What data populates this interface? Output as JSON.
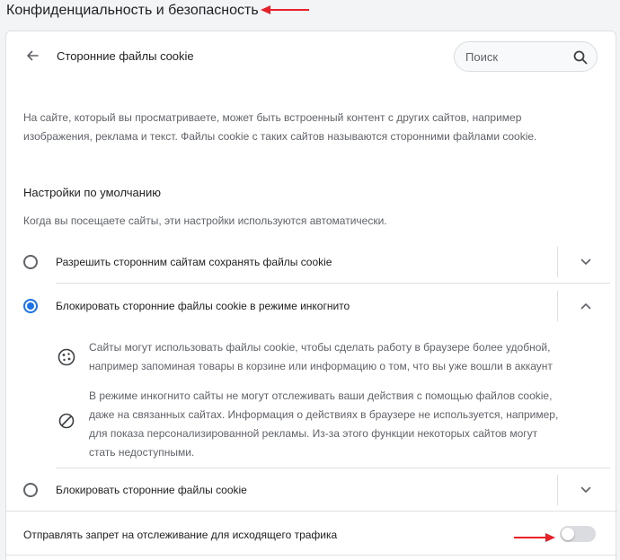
{
  "page": {
    "title": "Конфиденциальность и безопасность"
  },
  "header": {
    "title": "Сторонние файлы cookie",
    "search_placeholder": "Поиск"
  },
  "description": {
    "line1": "На сайте, который вы просматриваете, может быть встроенный контент с других сайтов, например",
    "line2": "изображения, реклама и текст. Файлы cookie с таких сайтов называются сторонними файлами cookie."
  },
  "defaults": {
    "title": "Настройки по умолчанию",
    "subtitle": "Когда вы посещаете сайты, эти настройки используются автоматически."
  },
  "options": [
    {
      "label": "Разрешить сторонним сайтам сохранять файлы cookie",
      "checked": false,
      "expanded": false
    },
    {
      "label": "Блокировать сторонние файлы cookie в режиме инкогнито",
      "checked": true,
      "expanded": true
    },
    {
      "label": "Блокировать сторонние файлы cookie",
      "checked": false,
      "expanded": false
    }
  ],
  "details": [
    {
      "icon": "cookie-icon",
      "lines": [
        "Сайты могут использовать файлы cookie, чтобы сделать работу в браузере более удобной,",
        "например запоминая товары в корзине или информацию о том, что вы уже вошли в аккаунт"
      ]
    },
    {
      "icon": "block-icon",
      "lines": [
        "В режиме инкогнито сайты не могут отслеживать ваши действия с помощью файлов cookie,",
        "даже на связанных сайтах. Информация о действиях в браузере не используется, например,",
        "для показа персонализированной рекламы. Из-за этого функции некоторых сайтов могут",
        "стать недоступными."
      ]
    }
  ],
  "do_not_track": {
    "label": "Отправлять запрет на отслеживание для исходящего трафика",
    "enabled": false
  },
  "colors": {
    "annotation_arrow": "#e8202a",
    "accent": "#1a73e8"
  }
}
